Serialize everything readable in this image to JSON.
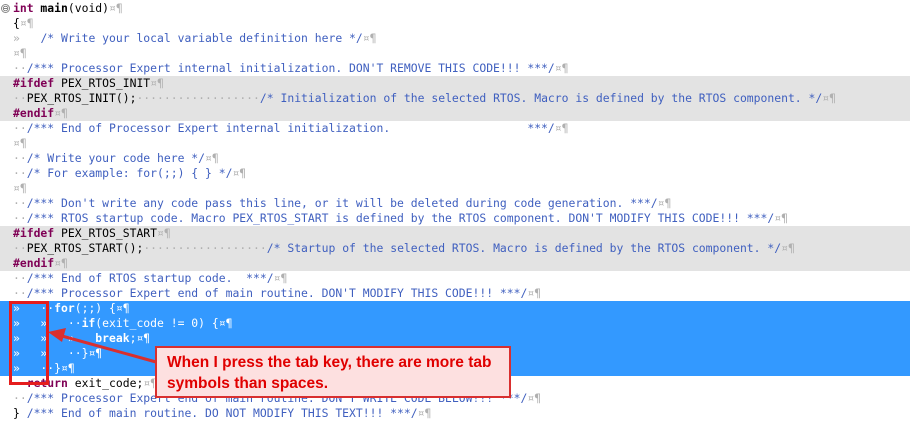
{
  "editor": {
    "lines": [
      {
        "style": "normal",
        "fold": "⊖",
        "segs": [
          [
            "kw",
            "int"
          ],
          [
            "fn",
            " main"
          ],
          [
            "plain",
            "(void)"
          ],
          [
            "ws",
            "¤¶"
          ]
        ]
      },
      {
        "style": "normal",
        "segs": [
          [
            "plain",
            "{"
          ],
          [
            "ws",
            "¤¶"
          ]
        ]
      },
      {
        "style": "normal",
        "segs": [
          [
            "ws",
            "»   "
          ],
          [
            "cmt",
            "/* Write your local variable definition here */"
          ],
          [
            "ws",
            "¤¶"
          ]
        ]
      },
      {
        "style": "normal",
        "segs": [
          [
            "ws",
            "¤¶"
          ]
        ]
      },
      {
        "style": "normal",
        "segs": [
          [
            "ws",
            "··"
          ],
          [
            "cmt",
            "/*** Processor Expert internal initialization. DON'T REMOVE THIS CODE!!! ***/"
          ],
          [
            "ws",
            "¤¶"
          ]
        ]
      },
      {
        "style": "grey",
        "segs": [
          [
            "pre",
            "#ifdef"
          ],
          [
            "plain",
            " PEX_RTOS_INIT"
          ],
          [
            "ws",
            "¤¶"
          ]
        ]
      },
      {
        "style": "grey",
        "segs": [
          [
            "ws",
            "··"
          ],
          [
            "plain",
            "PEX_RTOS_INIT();"
          ],
          [
            "ws",
            "··················"
          ],
          [
            "cmt",
            "/* Initialization of the selected RTOS. Macro is defined by the RTOS component. */"
          ],
          [
            "ws",
            "¤¶"
          ]
        ]
      },
      {
        "style": "grey",
        "segs": [
          [
            "pre",
            "#endif"
          ],
          [
            "ws",
            "¤¶"
          ]
        ]
      },
      {
        "style": "normal",
        "segs": [
          [
            "ws",
            "··"
          ],
          [
            "cmt",
            "/*** End of Processor Expert internal initialization.                    ***/"
          ],
          [
            "ws",
            "¤¶"
          ]
        ]
      },
      {
        "style": "normal",
        "segs": [
          [
            "ws",
            "¤¶"
          ]
        ]
      },
      {
        "style": "normal",
        "segs": [
          [
            "ws",
            "··"
          ],
          [
            "cmt",
            "/* Write your code here */"
          ],
          [
            "ws",
            "¤¶"
          ]
        ]
      },
      {
        "style": "normal",
        "segs": [
          [
            "ws",
            "··"
          ],
          [
            "cmt",
            "/* For example: for(;;) { } */"
          ],
          [
            "ws",
            "¤¶"
          ]
        ]
      },
      {
        "style": "normal",
        "segs": [
          [
            "ws",
            "¤¶"
          ]
        ]
      },
      {
        "style": "normal",
        "segs": [
          [
            "ws",
            "··"
          ],
          [
            "cmt",
            "/*** Don't write any code pass this line, or it will be deleted during code generation. ***/"
          ],
          [
            "ws",
            "¤¶"
          ]
        ]
      },
      {
        "style": "normal",
        "segs": [
          [
            "ws",
            "··"
          ],
          [
            "cmt",
            "/*** RTOS startup code. Macro PEX_RTOS_START is defined by the RTOS component. DON'T MODIFY THIS CODE!!! ***/"
          ],
          [
            "ws",
            "¤¶"
          ]
        ]
      },
      {
        "style": "grey",
        "segs": [
          [
            "pre",
            "#ifdef"
          ],
          [
            "plain",
            " PEX_RTOS_START"
          ],
          [
            "ws",
            "¤¶"
          ]
        ]
      },
      {
        "style": "grey",
        "segs": [
          [
            "ws",
            "··"
          ],
          [
            "plain",
            "PEX_RTOS_START();"
          ],
          [
            "ws",
            "··················"
          ],
          [
            "cmt",
            "/* Startup of the selected RTOS. Macro is defined by the RTOS component. */"
          ],
          [
            "ws",
            "¤¶"
          ]
        ]
      },
      {
        "style": "grey",
        "segs": [
          [
            "pre",
            "#endif"
          ],
          [
            "ws",
            "¤¶"
          ]
        ]
      },
      {
        "style": "normal",
        "segs": [
          [
            "ws",
            "··"
          ],
          [
            "cmt",
            "/*** End of RTOS startup code.  ***/"
          ],
          [
            "ws",
            "¤¶"
          ]
        ]
      },
      {
        "style": "normal",
        "segs": [
          [
            "ws",
            "··"
          ],
          [
            "cmt",
            "/*** Processor Expert end of main routine. DON'T MODIFY THIS CODE!!! ***/"
          ],
          [
            "ws",
            "¤¶"
          ]
        ]
      },
      {
        "style": "sel",
        "segs": [
          [
            "ws",
            "»   ··"
          ],
          [
            "kw",
            "for"
          ],
          [
            "plain",
            "(;;) {"
          ],
          [
            "ws",
            "¤¶"
          ]
        ]
      },
      {
        "style": "sel",
        "segs": [
          [
            "ws",
            "»   »   ··"
          ],
          [
            "kw",
            "if"
          ],
          [
            "plain",
            "(exit_code != 0) {"
          ],
          [
            "ws",
            "¤¶"
          ]
        ]
      },
      {
        "style": "sel",
        "segs": [
          [
            "ws",
            "»   »   »   "
          ],
          [
            "kw",
            "break"
          ],
          [
            "plain",
            ";"
          ],
          [
            "ws",
            "¤¶"
          ]
        ]
      },
      {
        "style": "sel",
        "segs": [
          [
            "ws",
            "»   »   ··"
          ],
          [
            "plain",
            "}"
          ],
          [
            "ws",
            "¤¶"
          ]
        ]
      },
      {
        "style": "sel",
        "segs": [
          [
            "ws",
            "»   ··"
          ],
          [
            "plain",
            "}"
          ],
          [
            "ws",
            "¤¶"
          ]
        ]
      },
      {
        "style": "normal",
        "segs": [
          [
            "ws",
            "··"
          ],
          [
            "kw",
            "return"
          ],
          [
            "plain",
            " exit_code;"
          ],
          [
            "ws",
            "¤¶"
          ]
        ]
      },
      {
        "style": "normal",
        "segs": [
          [
            "ws",
            "··"
          ],
          [
            "cmt",
            "/*** Processor Expert end of main routine. DON'T WRITE CODE BELOW!!! ***/"
          ],
          [
            "ws",
            "¤¶"
          ]
        ]
      },
      {
        "style": "normal",
        "segs": [
          [
            "plain",
            "}"
          ],
          [
            "cmt",
            " /*** End of main routine. DO NOT MODIFY THIS TEXT!!! ***/"
          ],
          [
            "ws",
            "¤¶"
          ]
        ]
      }
    ]
  },
  "annotation": {
    "callout_text": "When I press the tab key, there are more tab symbols than spaces.",
    "color": "#e51d1d"
  }
}
